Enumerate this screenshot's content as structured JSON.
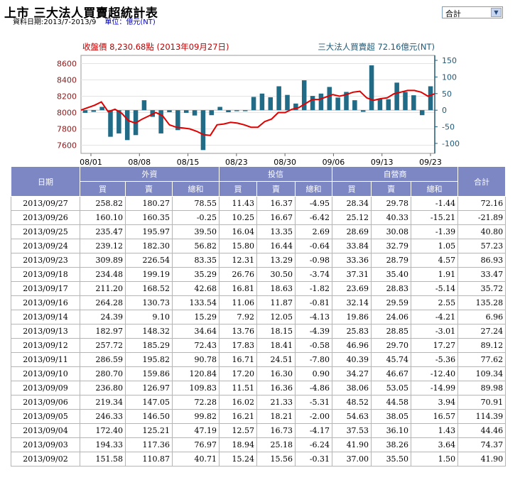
{
  "header": {
    "title": "上市 三大法人買賣超統計表",
    "date_range": "資料日期:2013/7-2013/9",
    "unit": "單位：億元(NT)"
  },
  "selector": {
    "value": "合計"
  },
  "colors": {
    "bar": "#226b87",
    "line": "#e00000",
    "left_axis_text": "#8b1a1a",
    "right_axis_text": "#1e5a78",
    "header_bg": "#7c87c4"
  },
  "chart_data": {
    "type": "bar",
    "title_left": "收盤價 8,230.68點 (2013年09月27日)",
    "title_right": "三大法人買賣超 72.16億元(NT)",
    "left_axis_ticks": [
      "8600",
      "8400",
      "8200",
      "8000",
      "7800",
      "7600"
    ],
    "right_axis_ticks": [
      "150",
      "100",
      "50",
      "0",
      "-50",
      "-100"
    ],
    "x_tick_labels": [
      "08/01",
      "08/08",
      "08/15",
      "08/23",
      "08/30",
      "09/06",
      "09/13",
      "09/23"
    ],
    "left_ylim": [
      7500,
      8700
    ],
    "right_ylim": [
      -130,
      165
    ],
    "bar_series": {
      "name": "三大法人買賣超",
      "values": [
        -8,
        -5,
        10,
        -80,
        -70,
        -90,
        -75,
        30,
        -20,
        -70,
        -6,
        -60,
        -8,
        -16,
        -120,
        -15,
        10,
        -6,
        -3,
        -3,
        40,
        50,
        39,
        72,
        46,
        20,
        90,
        43,
        50,
        70,
        38,
        55,
        30,
        -5,
        135,
        35,
        33,
        83,
        55,
        45,
        -15,
        72
      ]
    },
    "line_series": {
      "name": "收盤價",
      "values": [
        8030,
        8060,
        8090,
        8130,
        8010,
        8040,
        7990,
        7900,
        7870,
        7920,
        7960,
        8000,
        7960,
        7850,
        7820,
        7810,
        7800,
        7770,
        7730,
        7720,
        7850,
        7860,
        7880,
        7870,
        7850,
        7820,
        7820,
        7890,
        7920,
        8000,
        8000,
        8040,
        8060,
        8110,
        8160,
        8160,
        8190,
        8220,
        8200,
        8220,
        8250,
        8260,
        8180,
        8150,
        8170,
        8180,
        8230,
        8250,
        8270,
        8270,
        8250,
        8200,
        8230
      ]
    }
  },
  "table": {
    "group_headers": [
      "日期",
      "外資",
      "投信",
      "自營商",
      "合計"
    ],
    "sub_headers": [
      "買",
      "賣",
      "總和",
      "買",
      "賣",
      "總和",
      "買",
      "賣",
      "總和"
    ],
    "rows": [
      [
        "2013/09/27",
        "258.82",
        "180.27",
        "78.55",
        "11.43",
        "16.37",
        "-4.95",
        "28.34",
        "29.78",
        "-1.44",
        "72.16"
      ],
      [
        "2013/09/26",
        "160.10",
        "160.35",
        "-0.25",
        "10.25",
        "16.67",
        "-6.42",
        "25.12",
        "40.33",
        "-15.21",
        "-21.89"
      ],
      [
        "2013/09/25",
        "235.47",
        "195.97",
        "39.50",
        "16.04",
        "13.35",
        "2.69",
        "28.69",
        "30.08",
        "-1.39",
        "40.80"
      ],
      [
        "2013/09/24",
        "239.12",
        "182.30",
        "56.82",
        "15.80",
        "16.44",
        "-0.64",
        "33.84",
        "32.79",
        "1.05",
        "57.23"
      ],
      [
        "2013/09/23",
        "309.89",
        "226.54",
        "83.35",
        "12.31",
        "13.29",
        "-0.98",
        "33.36",
        "28.79",
        "4.57",
        "86.93"
      ],
      [
        "2013/09/18",
        "234.48",
        "199.19",
        "35.29",
        "26.76",
        "30.50",
        "-3.74",
        "37.31",
        "35.40",
        "1.91",
        "33.47"
      ],
      [
        "2013/09/17",
        "211.20",
        "168.52",
        "42.68",
        "16.81",
        "18.63",
        "-1.82",
        "23.69",
        "28.83",
        "-5.14",
        "35.72"
      ],
      [
        "2013/09/16",
        "264.28",
        "130.73",
        "133.54",
        "11.06",
        "11.87",
        "-0.81",
        "32.14",
        "29.59",
        "2.55",
        "135.28"
      ],
      [
        "2013/09/14",
        "24.39",
        "9.10",
        "15.29",
        "7.92",
        "12.05",
        "-4.13",
        "19.86",
        "24.06",
        "-4.21",
        "6.96"
      ],
      [
        "2013/09/13",
        "182.97",
        "148.32",
        "34.64",
        "13.76",
        "18.15",
        "-4.39",
        "25.83",
        "28.85",
        "-3.01",
        "27.24"
      ],
      [
        "2013/09/12",
        "257.72",
        "185.29",
        "72.43",
        "17.83",
        "18.41",
        "-0.58",
        "46.96",
        "29.70",
        "17.27",
        "89.12"
      ],
      [
        "2013/09/11",
        "286.59",
        "195.82",
        "90.78",
        "16.71",
        "24.51",
        "-7.80",
        "40.39",
        "45.74",
        "-5.36",
        "77.62"
      ],
      [
        "2013/09/10",
        "280.70",
        "159.86",
        "120.84",
        "17.20",
        "16.30",
        "0.90",
        "34.27",
        "46.67",
        "-12.40",
        "109.34"
      ],
      [
        "2013/09/09",
        "236.80",
        "126.97",
        "109.83",
        "11.51",
        "16.36",
        "-4.86",
        "38.06",
        "53.05",
        "-14.99",
        "89.98"
      ],
      [
        "2013/09/06",
        "219.34",
        "147.05",
        "72.28",
        "16.02",
        "21.33",
        "-5.31",
        "48.52",
        "44.58",
        "3.94",
        "70.91"
      ],
      [
        "2013/09/05",
        "246.33",
        "146.50",
        "99.82",
        "16.21",
        "18.21",
        "-2.00",
        "54.63",
        "38.05",
        "16.57",
        "114.39"
      ],
      [
        "2013/09/04",
        "172.40",
        "125.21",
        "47.19",
        "12.57",
        "16.73",
        "-4.17",
        "37.53",
        "36.10",
        "1.43",
        "44.46"
      ],
      [
        "2013/09/03",
        "194.33",
        "117.36",
        "76.97",
        "18.94",
        "25.18",
        "-6.24",
        "41.90",
        "38.26",
        "3.64",
        "74.37"
      ],
      [
        "2013/09/02",
        "151.58",
        "110.87",
        "40.71",
        "15.24",
        "15.56",
        "-0.31",
        "37.00",
        "35.50",
        "1.50",
        "41.90"
      ]
    ]
  }
}
